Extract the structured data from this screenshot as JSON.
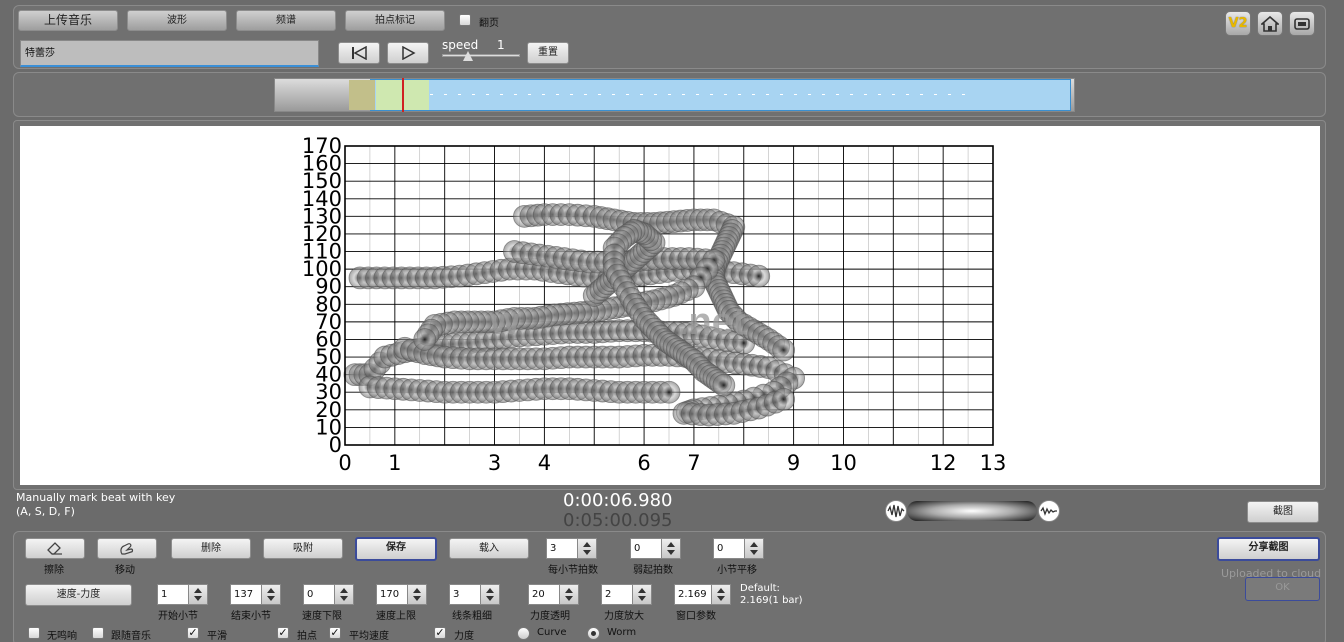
{
  "toolbar": {
    "upload_label": "上传音乐",
    "waveform_label": "波形",
    "spectrum_label": "频谱",
    "beat_mark_label": "拍点标记",
    "flip_label": "翻页",
    "song_input_value": "特蕾莎",
    "speed_label": "speed",
    "speed_value": "1",
    "reset_label": "重置",
    "v2_label": "V2"
  },
  "timeline": {
    "selection_start_fraction": 0.12,
    "selection_end_fraction": 0.995,
    "playhead_fraction": 0.16
  },
  "plot": {
    "watermark": "w               .net"
  },
  "chart_data": {
    "type": "scatter",
    "x_ticks": [
      "0",
      "1",
      "3",
      "4",
      "6",
      "7",
      "9",
      "10",
      "12",
      "13"
    ],
    "y_ticks": [
      "0",
      "10",
      "20",
      "30",
      "40",
      "50",
      "60",
      "70",
      "80",
      "90",
      "100",
      "110",
      "120",
      "130",
      "140",
      "150",
      "160",
      "170"
    ],
    "xlim": [
      0,
      13
    ],
    "ylim": [
      0,
      170
    ],
    "grid": true,
    "series": [
      {
        "values": [
          [
            0.2,
            40
          ],
          [
            0.5,
            40
          ],
          [
            0.8,
            50
          ],
          [
            1.2,
            53
          ],
          [
            1.6,
            55
          ],
          [
            2.0,
            57
          ],
          [
            2.5,
            58
          ],
          [
            3.0,
            60
          ],
          [
            3.5,
            62
          ],
          [
            4.0,
            63
          ],
          [
            4.5,
            64
          ],
          [
            5.0,
            64
          ],
          [
            5.5,
            65
          ],
          [
            6.0,
            65
          ],
          [
            6.5,
            64
          ],
          [
            7.0,
            63
          ],
          [
            7.5,
            60
          ],
          [
            8.0,
            58
          ]
        ]
      },
      {
        "values": [
          [
            0.3,
            95
          ],
          [
            0.8,
            95
          ],
          [
            1.3,
            95
          ],
          [
            1.8,
            95
          ],
          [
            2.3,
            96
          ],
          [
            2.8,
            98
          ],
          [
            3.3,
            100
          ],
          [
            3.8,
            100
          ],
          [
            4.3,
            98
          ],
          [
            4.8,
            96
          ],
          [
            5.3,
            95
          ],
          [
            5.8,
            96
          ],
          [
            6.3,
            98
          ],
          [
            6.8,
            100
          ],
          [
            7.3,
            100
          ],
          [
            7.8,
            98
          ],
          [
            8.3,
            96
          ]
        ]
      },
      {
        "values": [
          [
            0.5,
            33
          ],
          [
            1.0,
            32
          ],
          [
            1.5,
            31
          ],
          [
            2.0,
            30
          ],
          [
            2.5,
            30
          ],
          [
            3.0,
            30
          ],
          [
            3.5,
            31
          ],
          [
            4.0,
            32
          ],
          [
            4.5,
            32
          ],
          [
            5.0,
            31
          ],
          [
            5.5,
            30
          ],
          [
            6.0,
            30
          ],
          [
            6.5,
            30
          ]
        ]
      },
      {
        "values": [
          [
            1.2,
            55
          ],
          [
            1.6,
            52
          ],
          [
            2.0,
            50
          ],
          [
            2.5,
            49
          ],
          [
            3.0,
            49
          ],
          [
            3.5,
            49
          ],
          [
            4.0,
            49
          ],
          [
            4.5,
            50
          ],
          [
            5.0,
            50
          ],
          [
            5.5,
            50
          ],
          [
            6.0,
            51
          ],
          [
            6.5,
            51
          ],
          [
            7.0,
            50
          ],
          [
            7.5,
            48
          ],
          [
            8.0,
            46
          ],
          [
            8.5,
            44
          ],
          [
            9.0,
            38
          ],
          [
            8.6,
            30
          ],
          [
            8.0,
            25
          ],
          [
            7.5,
            22
          ],
          [
            7.0,
            20
          ],
          [
            6.8,
            18
          ],
          [
            7.3,
            17
          ],
          [
            7.8,
            18
          ],
          [
            8.3,
            21
          ],
          [
            8.8,
            26
          ]
        ]
      },
      {
        "values": [
          [
            3.6,
            130
          ],
          [
            4.0,
            131
          ],
          [
            4.5,
            131
          ],
          [
            5.0,
            130
          ],
          [
            5.4,
            128
          ],
          [
            5.8,
            126
          ],
          [
            6.2,
            126
          ],
          [
            6.6,
            127
          ],
          [
            7.0,
            128
          ],
          [
            7.4,
            128
          ],
          [
            7.8,
            124
          ],
          [
            7.7,
            118
          ],
          [
            7.6,
            112
          ],
          [
            7.5,
            106
          ],
          [
            7.4,
            100
          ],
          [
            7.4,
            94
          ],
          [
            7.5,
            88
          ],
          [
            7.6,
            82
          ],
          [
            7.7,
            76
          ],
          [
            7.9,
            70
          ],
          [
            8.2,
            65
          ],
          [
            8.5,
            60
          ],
          [
            8.8,
            54
          ]
        ]
      },
      {
        "values": [
          [
            3.4,
            110
          ],
          [
            3.9,
            108
          ],
          [
            4.4,
            106
          ],
          [
            4.9,
            104
          ],
          [
            5.4,
            104
          ],
          [
            5.9,
            105
          ],
          [
            6.4,
            106
          ],
          [
            6.9,
            106
          ],
          [
            7.4,
            105
          ],
          [
            7.0,
            90
          ],
          [
            6.6,
            85
          ],
          [
            6.2,
            82
          ],
          [
            5.8,
            80
          ],
          [
            5.4,
            78
          ],
          [
            5.0,
            76
          ],
          [
            4.6,
            75
          ],
          [
            4.2,
            74
          ],
          [
            3.8,
            72
          ],
          [
            3.4,
            72
          ],
          [
            3.0,
            70
          ],
          [
            2.6,
            70
          ],
          [
            2.2,
            70
          ],
          [
            1.8,
            68
          ],
          [
            1.6,
            60
          ]
        ]
      },
      {
        "values": [
          [
            5.0,
            85
          ],
          [
            5.2,
            90
          ],
          [
            5.4,
            95
          ],
          [
            5.6,
            100
          ],
          [
            5.8,
            105
          ],
          [
            6.0,
            110
          ],
          [
            6.2,
            115
          ],
          [
            6.0,
            120
          ],
          [
            5.8,
            122
          ],
          [
            5.6,
            118
          ],
          [
            5.4,
            112
          ],
          [
            5.4,
            100
          ],
          [
            5.6,
            90
          ],
          [
            5.8,
            80
          ],
          [
            6.0,
            72
          ],
          [
            6.2,
            66
          ],
          [
            6.4,
            60
          ],
          [
            6.6,
            56
          ],
          [
            6.8,
            52
          ],
          [
            7.0,
            48
          ],
          [
            7.2,
            42
          ],
          [
            7.4,
            38
          ],
          [
            7.6,
            34
          ]
        ]
      }
    ]
  },
  "status": {
    "hint_line1": "Manually mark beat with key",
    "hint_line2": "(A, S, D, F)",
    "current_time": "0:00:06.980",
    "total_time": "0:05:00.095",
    "screenshot_label": "截图"
  },
  "tools": {
    "erase_label": "擦除",
    "move_label": "移动",
    "delete_label": "删除",
    "snap_label": "吸附",
    "save_label": "保存",
    "load_label": "载入",
    "beats_per_bar_value": "3",
    "beats_per_bar_label": "每小节拍数",
    "pickup_value": "0",
    "pickup_label": "弱起拍数",
    "bar_shift_value": "0",
    "bar_shift_label": "小节平移",
    "share_label": "分享截图",
    "uploaded_label": "Uploaded to cloud",
    "ok_label": "OK",
    "mode_label": "速度-力度",
    "start_bar_value": "1",
    "start_bar_label": "开始小节",
    "end_bar_value": "137",
    "end_bar_label": "结束小节",
    "tempo_min_value": "0",
    "tempo_min_label": "速度下限",
    "tempo_max_value": "170",
    "tempo_max_label": "速度上限",
    "line_width_value": "3",
    "line_width_label": "线条粗细",
    "opacity_value": "20",
    "opacity_label": "力度透明",
    "dyn_scale_value": "2",
    "dyn_scale_label": "力度放大",
    "window_value": "2.169",
    "window_label": "窗口参数",
    "default_line1": "Default:",
    "default_line2": "2.169(1 bar)",
    "opt_no_bars_label": "无鸣响",
    "opt_follow_label": "跟随音乐",
    "opt_smooth_label": "平滑",
    "opt_beats_label": "拍点",
    "opt_avg_tempo_label": "平均速度",
    "opt_dynamics_label": "力度",
    "curve_label": "Curve",
    "worm_label": "Worm"
  }
}
